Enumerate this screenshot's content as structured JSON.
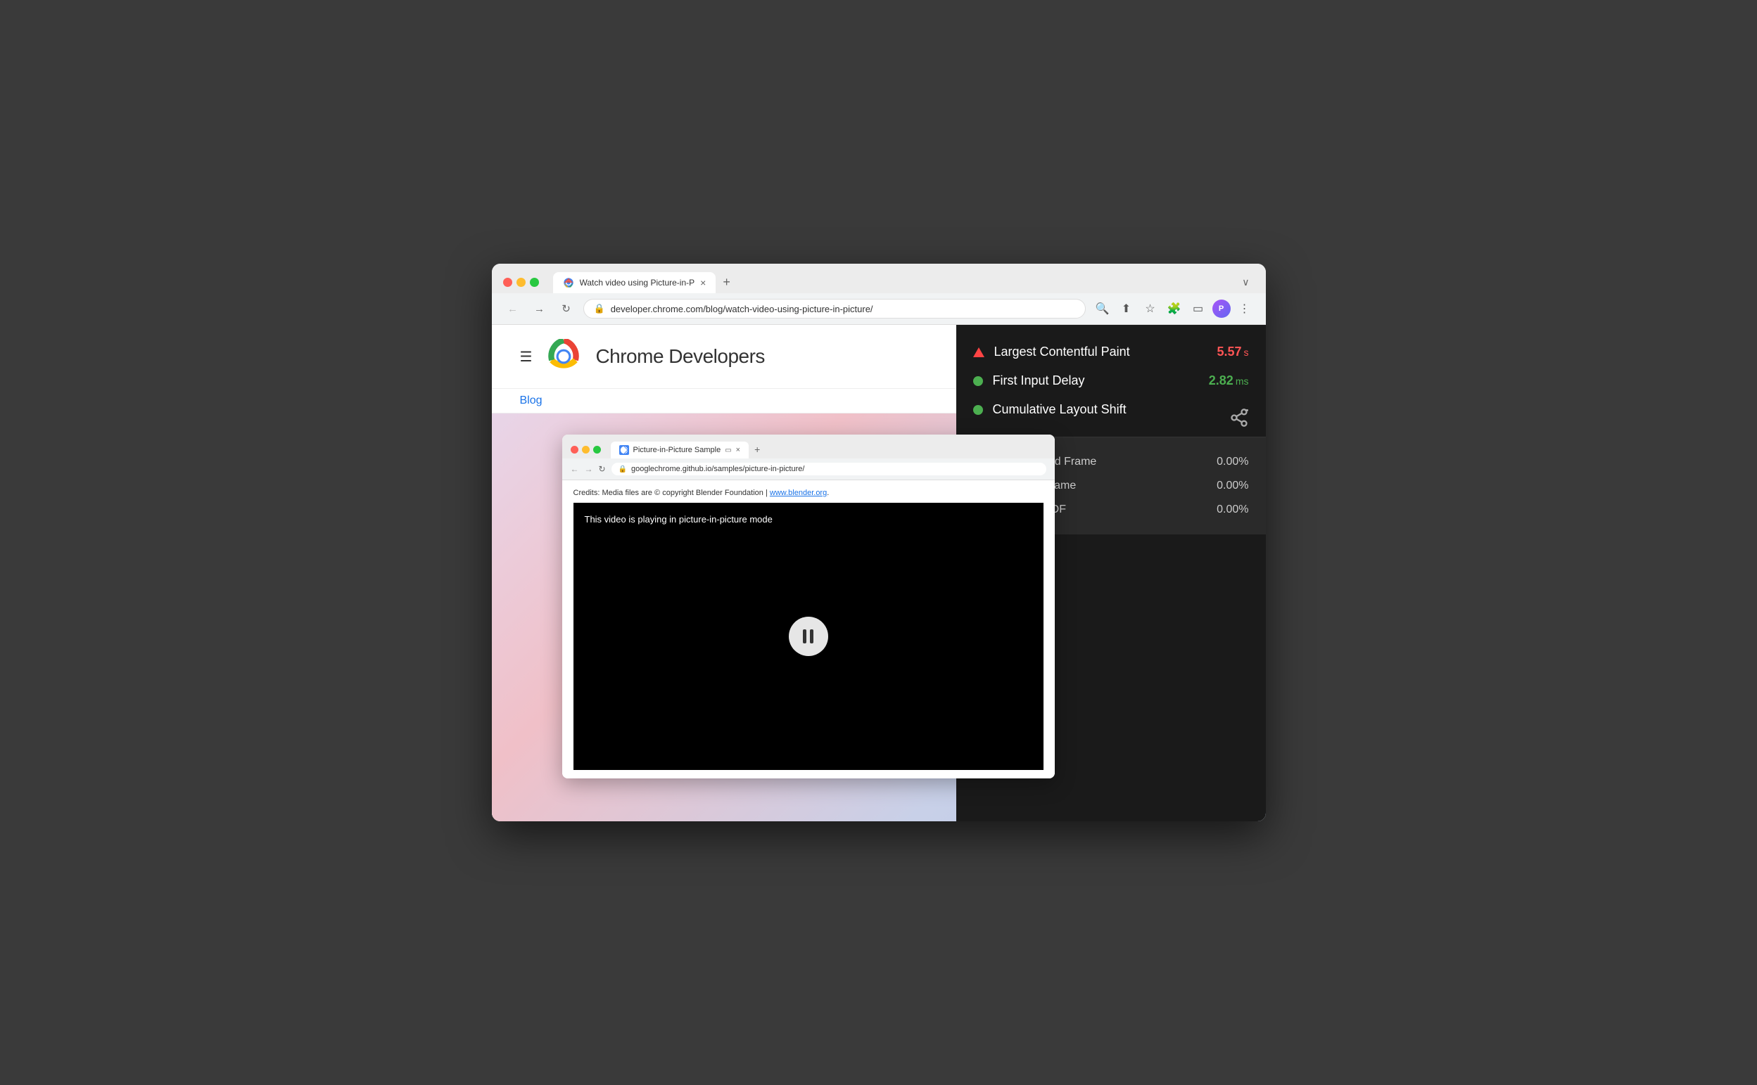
{
  "browser": {
    "tab_title": "Watch video using Picture-in-P",
    "url": "developer.chrome.com/blog/watch-video-using-picture-in-picture/",
    "new_tab_label": "+",
    "expand_label": "∨"
  },
  "site": {
    "title": "Chrome Developers",
    "nav_link": "Blog",
    "hero_text": ""
  },
  "inner_browser": {
    "tab_title": "Picture-in-Picture Sample",
    "url": "googlechrome.github.io/samples/picture-in-picture/",
    "credits": "Credits: Media files are © copyright Blender Foundation |",
    "credits_link": "www.blender.org",
    "video_caption": "This video is playing in picture-in-picture mode"
  },
  "perf_panel": {
    "metrics": [
      {
        "name": "Largest Contentful Paint",
        "value": "5.57",
        "unit": "s",
        "color": "#ff4444",
        "indicator_type": "triangle"
      },
      {
        "name": "First Input Delay",
        "value": "2.82",
        "unit": "ms",
        "color": "#4caf50",
        "indicator_type": "circle"
      },
      {
        "name": "Cumulative Layout Shift",
        "value": "-",
        "unit": "",
        "color": "#4caf50",
        "indicator_type": "circle"
      }
    ],
    "frame_metrics": [
      {
        "name": "Average Dropped Frame",
        "value": "0.00%"
      },
      {
        "name": "Max Dropped Frame",
        "value": "0.00%"
      },
      {
        "name": "95th Percentile DF",
        "value": "0.00%"
      }
    ]
  }
}
